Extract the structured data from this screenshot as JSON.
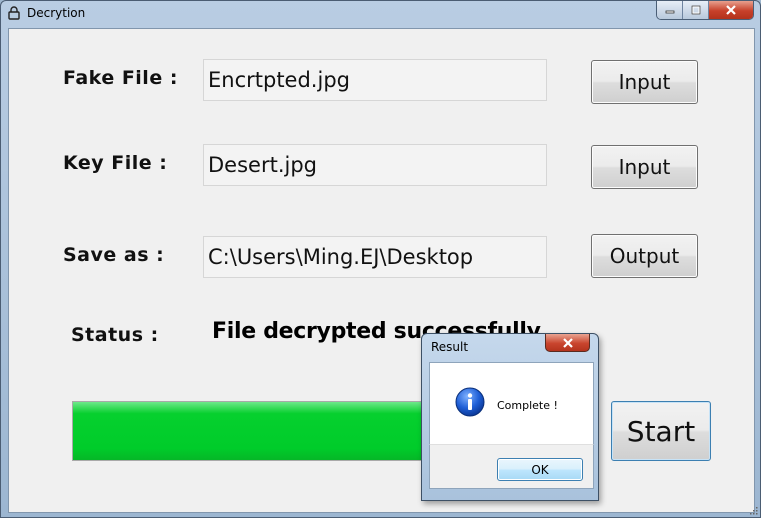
{
  "window": {
    "title": "Decrytion",
    "icon": "lock-icon",
    "controls": {
      "minimize_icon": "minimize-icon",
      "maximize_icon": "maximize-icon",
      "close_icon": "close-icon"
    }
  },
  "form": {
    "fake_file": {
      "label": "Fake File :",
      "value": "Encrtpted.jpg",
      "button": "Input"
    },
    "key_file": {
      "label": "Key File :",
      "value": "Desert.jpg",
      "button": "Input"
    },
    "save_as": {
      "label": "Save as :",
      "value": "C:\\Users\\Ming.EJ\\Desktop",
      "button": "Output"
    }
  },
  "status": {
    "label": "Status :",
    "value": "File decrypted successfully"
  },
  "progress": {
    "percent": 100,
    "color": "#00cc2a"
  },
  "start_button": "Start",
  "dialog": {
    "title": "Result",
    "message": "Complete !",
    "icon": "info-icon",
    "ok_label": "OK"
  }
}
